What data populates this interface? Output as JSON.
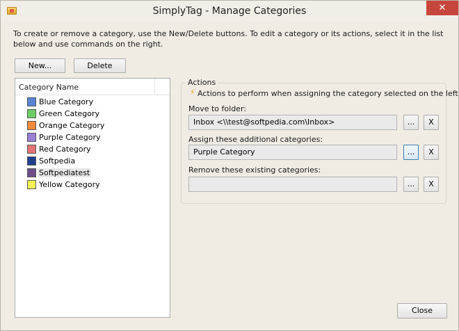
{
  "window": {
    "title": "SimplyTag - Manage Categories",
    "close_glyph": "✕"
  },
  "instructions": "To create or remove a category, use the New/Delete buttons. To edit a category or its actions, select it in the list below and use commands on the right.",
  "toolbar": {
    "new_label": "New...",
    "delete_label": "Delete"
  },
  "category_list": {
    "header": "Category Name",
    "items": [
      {
        "label": "Blue Category",
        "color": "#5a84d6"
      },
      {
        "label": "Green Category",
        "color": "#6dcf63"
      },
      {
        "label": "Orange Category",
        "color": "#f58a3a"
      },
      {
        "label": "Purple Category",
        "color": "#9b7ed8"
      },
      {
        "label": "Red Category",
        "color": "#e37578"
      },
      {
        "label": "Softpedia",
        "color": "#1f3f8c"
      },
      {
        "label": "Softpediatest",
        "color": "#6a4f8a"
      },
      {
        "label": "Yellow Category",
        "color": "#f6f255"
      }
    ],
    "selected_index": 6
  },
  "actions": {
    "group_label": "Actions",
    "description": "Actions to perform when assigning the category selected on the left.",
    "move_label": "Move to folder:",
    "move_value": "Inbox <\\\\test@softpedia.com\\Inbox>",
    "assign_label": "Assign these additional categories:",
    "assign_value": "Purple Category",
    "remove_label": "Remove these existing categories:",
    "remove_value": "",
    "browse_label": "...",
    "clear_label": "X"
  },
  "footer": {
    "close_label": "Close"
  }
}
